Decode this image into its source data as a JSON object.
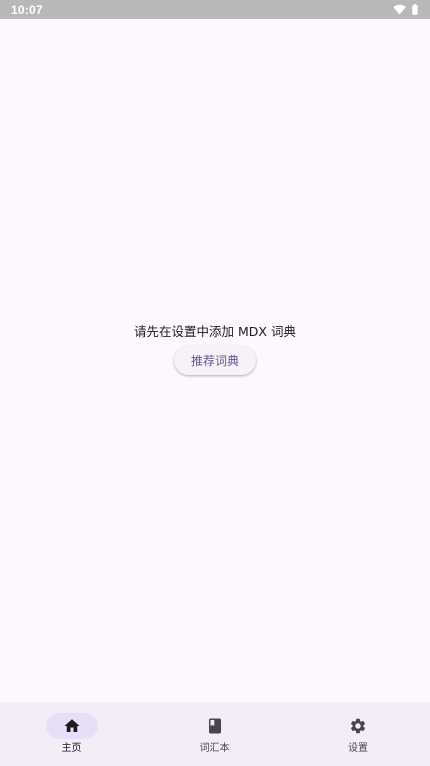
{
  "status_bar": {
    "time": "10:07",
    "icons": [
      "wifi-icon",
      "battery-icon"
    ]
  },
  "main": {
    "empty_message": "请先在设置中添加 MDX 词典",
    "recommend_button_label": "推荐词典"
  },
  "bottom_nav": {
    "items": [
      {
        "label": "主页",
        "icon": "home-icon",
        "selected": true
      },
      {
        "label": "词汇本",
        "icon": "book-icon",
        "selected": false
      },
      {
        "label": "设置",
        "icon": "gear-icon",
        "selected": false
      }
    ]
  },
  "colors": {
    "background": "#fef7ff",
    "status_bar": "#b8b8b8",
    "nav_background": "#f3edf7",
    "nav_indicator": "#e8def8",
    "accent_text": "#65558f"
  }
}
